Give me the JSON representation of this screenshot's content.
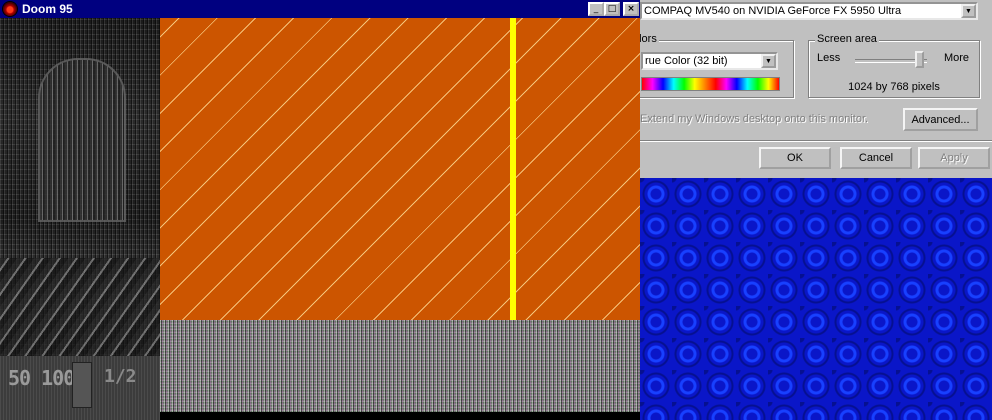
{
  "doom_window": {
    "title": "Doom 95",
    "buttons": {
      "minimize": "_",
      "maximize": "□",
      "close": "×"
    },
    "hud": {
      "ammo_health": "50 100%",
      "keys": "1/2"
    },
    "colors": {
      "wall": "#cc5500",
      "pillar": "#ffff00",
      "titlebar": "#000080"
    }
  },
  "display_properties": {
    "monitor_select": "COMPAQ MV540 on NVIDIA GeForce FX 5950 Ultra",
    "colors_group": {
      "legend": "olors",
      "selected": "rue Color (32 bit)"
    },
    "screen_area": {
      "legend": "Screen area",
      "less": "Less",
      "more": "More",
      "resolution": "1024 by 768 pixels",
      "slider_level": 0.9
    },
    "extend_checkbox_label": "Extend my Windows desktop onto this monitor.",
    "advanced_button": "Advanced...",
    "ok_button": "OK",
    "cancel_button": "Cancel",
    "apply_button": "Apply"
  },
  "desktop": {
    "wallpaper_color": "#0a16c8"
  }
}
